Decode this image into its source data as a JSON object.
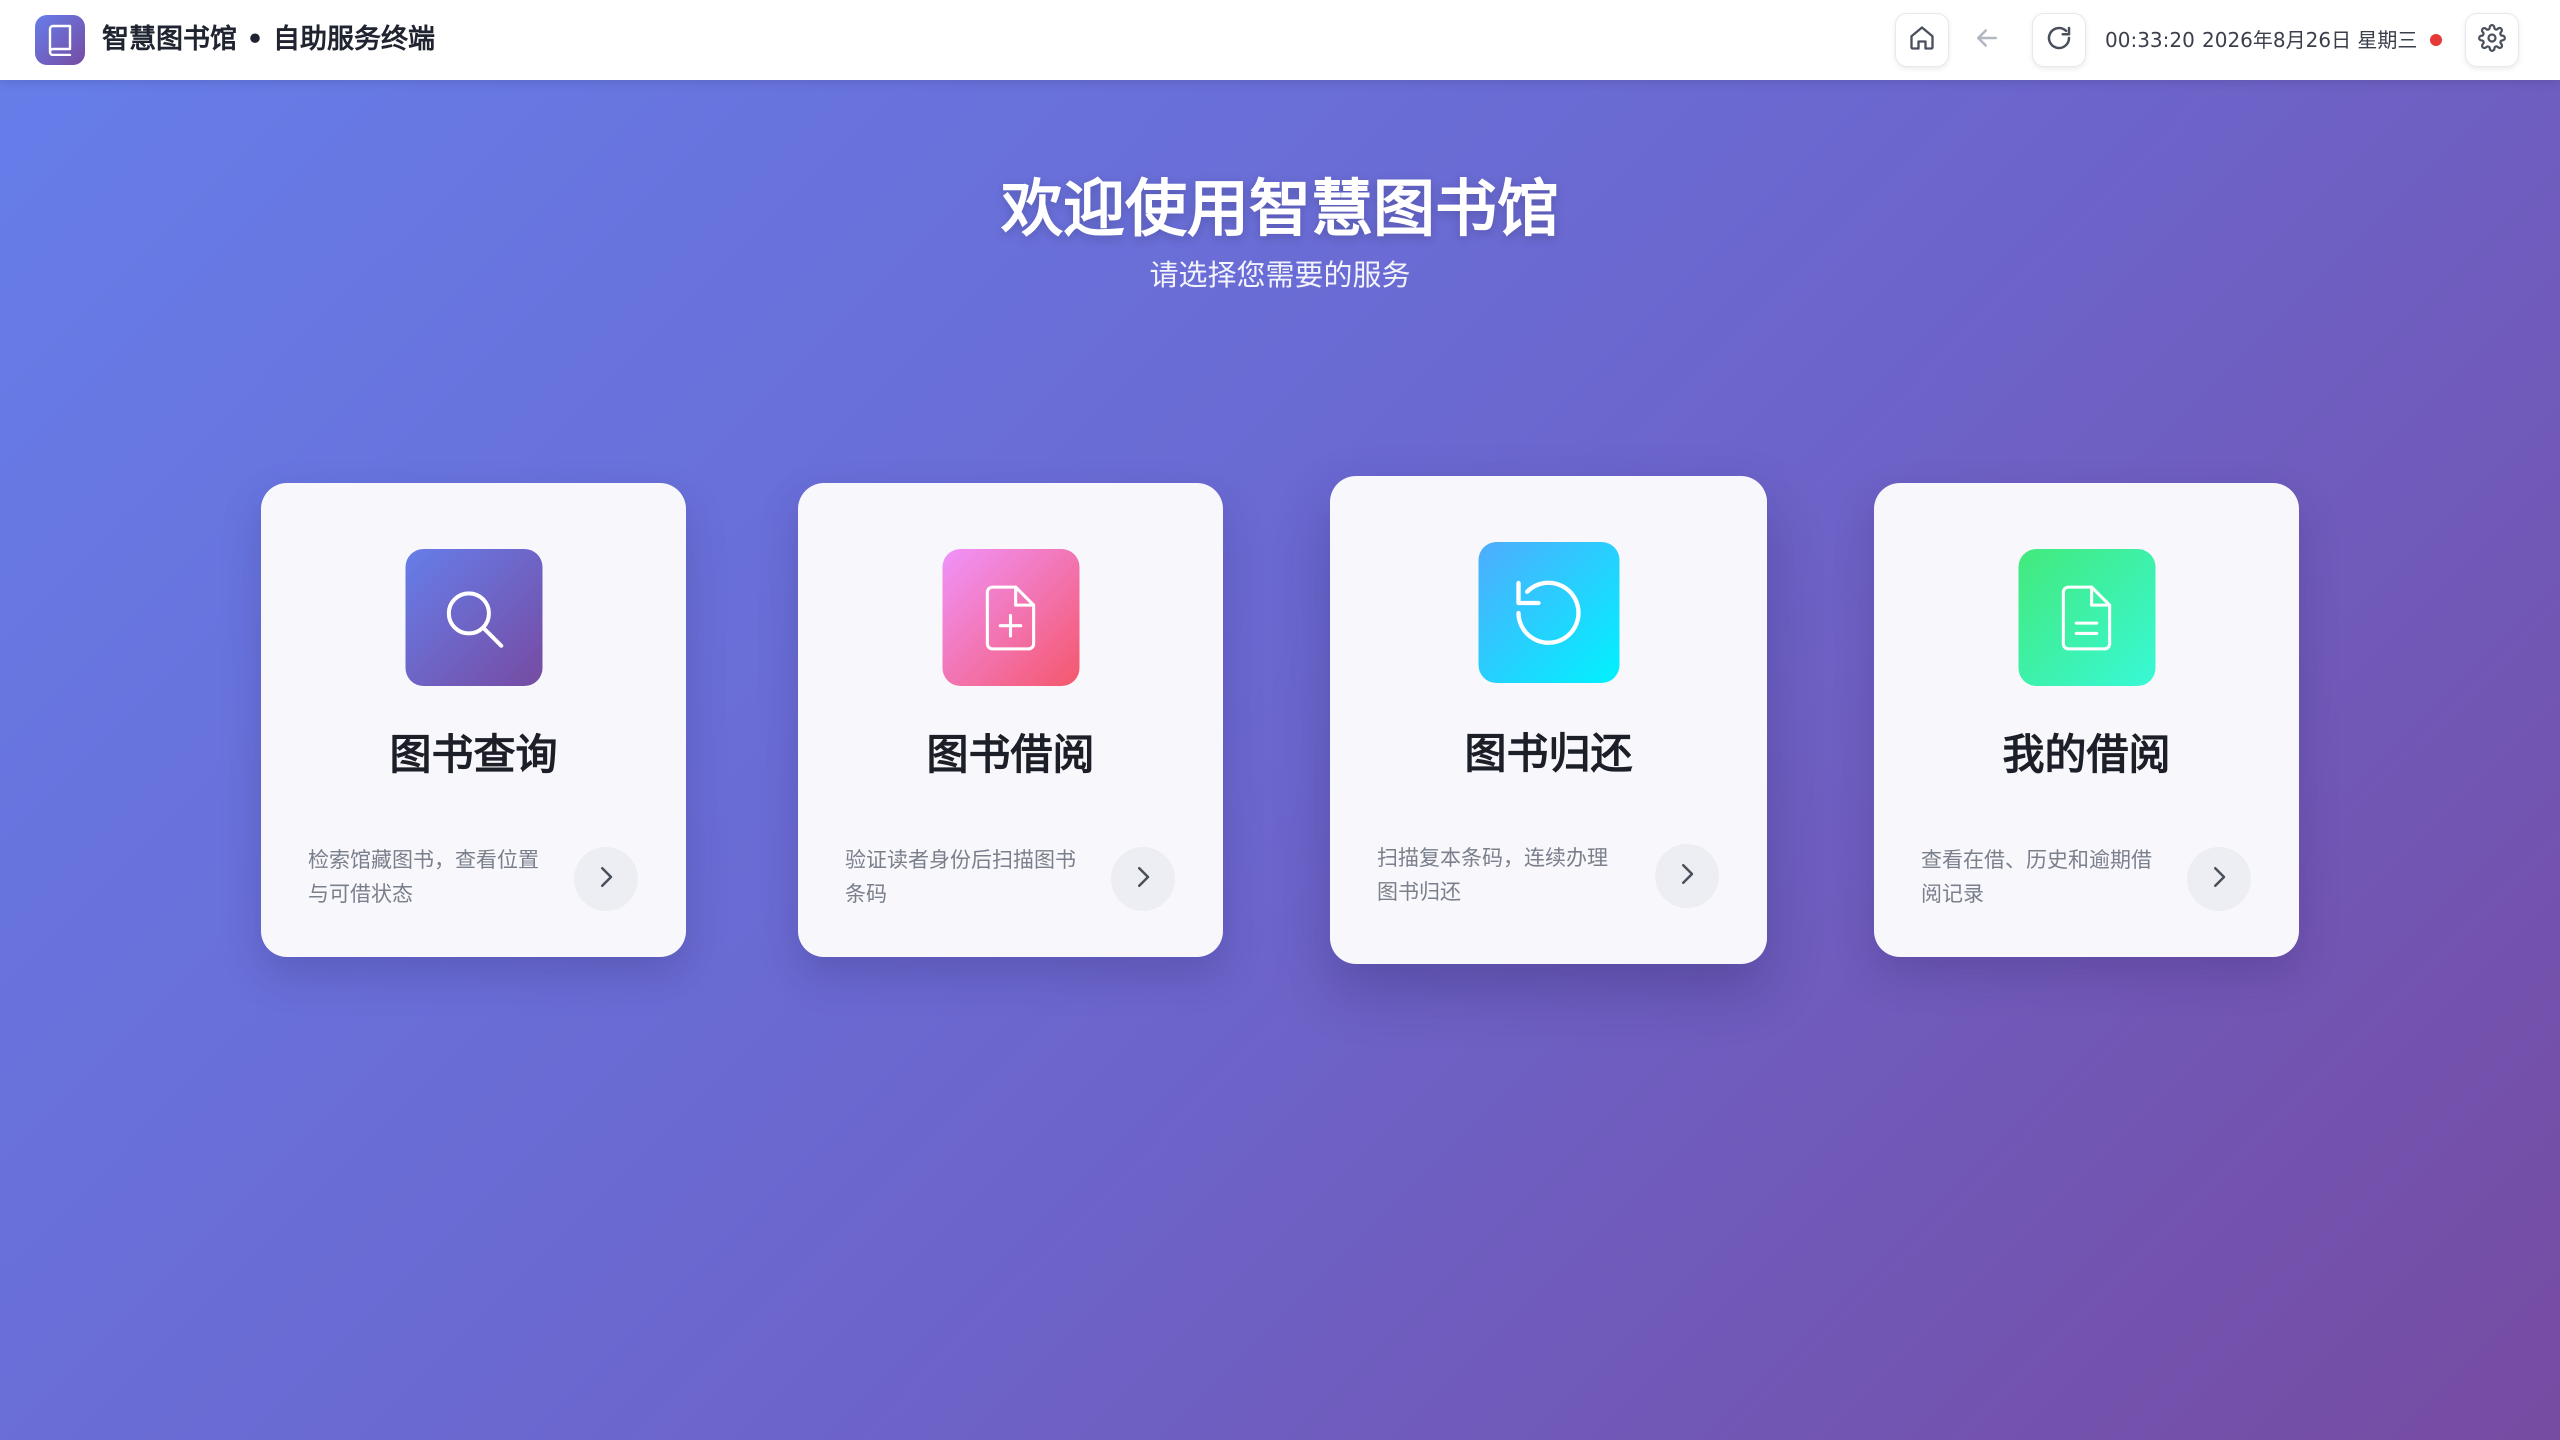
{
  "app": {
    "title": "智慧图书馆 • 自助服务终端",
    "logo_icon": "book-icon"
  },
  "topbar": {
    "time": "00:33:20",
    "date": "2026年8月26日 星期三",
    "status_color": "#e53935",
    "buttons": [
      "home-icon",
      "arrow-left-icon",
      "refresh-icon",
      "gear-icon"
    ]
  },
  "hero": {
    "title": "欢迎使用智慧图书馆",
    "subtitle": "请选择您需要的服务"
  },
  "cards": [
    {
      "title": "图书查询",
      "desc": "检索馆藏图书，查看位置与可借状态",
      "icon": "search-icon",
      "gradient": [
        "#667eea",
        "#764ba2"
      ]
    },
    {
      "title": "图书借阅",
      "desc": "验证读者身份后扫描图书条码",
      "icon": "document-plus-icon",
      "gradient": [
        "#f093fb",
        "#f5576c"
      ]
    },
    {
      "title": "图书归还",
      "desc": "扫描复本条码，连续办理图书归还",
      "icon": "rotate-ccw-icon",
      "gradient": [
        "#4facfe",
        "#00f2fe"
      ]
    },
    {
      "title": "我的借阅",
      "desc": "查看在借、历史和逾期借阅记录",
      "icon": "document-lines-icon",
      "gradient": [
        "#43e97b",
        "#38f9d7"
      ]
    }
  ]
}
